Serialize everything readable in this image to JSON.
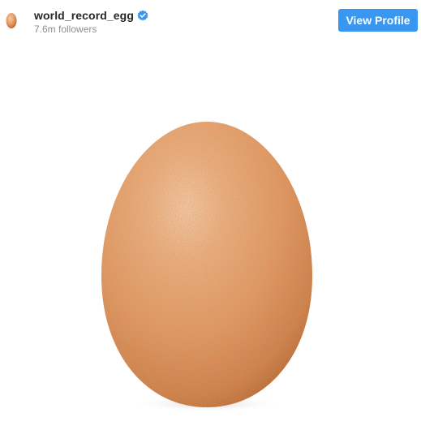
{
  "post_header": {
    "username": "world_record_egg",
    "followers": "7.6m followers",
    "verified": true,
    "view_profile_label": "View Profile"
  },
  "colors": {
    "button_bg": "#3897f0",
    "button_text": "#ffffff",
    "username": "#262626",
    "followers": "#8e8e8e",
    "verified_badge": "#3897f0",
    "egg_light": "#f3b88e",
    "egg_mid": "#e59a63",
    "egg_dark": "#c4703a"
  },
  "icons": {
    "avatar": "egg-avatar-icon",
    "verified": "verified-badge-icon"
  }
}
